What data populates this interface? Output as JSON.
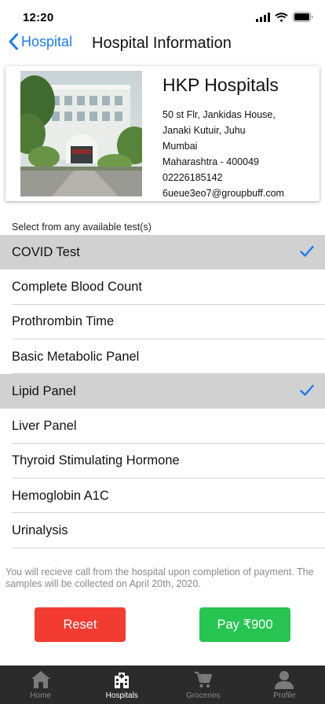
{
  "status": {
    "time": "12:20"
  },
  "nav": {
    "back_label": "Hospital",
    "title": "Hospital Information"
  },
  "hospital": {
    "name": "HKP Hospitals",
    "address_lines": [
      "50 st Flr, Jankidas House,",
      "Janaki Kutuir, Juhu",
      "Mumbai",
      "Maharashtra - 400049",
      "02226185142",
      "6ueue3eo7@groupbuff.com"
    ]
  },
  "tests": {
    "caption": "Select from any available test(s)",
    "items": [
      {
        "label": "COVID Test",
        "selected": true
      },
      {
        "label": "Complete Blood Count",
        "selected": false
      },
      {
        "label": "Prothrombin Time",
        "selected": false
      },
      {
        "label": "Basic Metabolic Panel",
        "selected": false
      },
      {
        "label": "Lipid Panel",
        "selected": true
      },
      {
        "label": "Liver Panel",
        "selected": false
      },
      {
        "label": "Thyroid Stimulating Hormone",
        "selected": false
      },
      {
        "label": "Hemoglobin A1C",
        "selected": false
      },
      {
        "label": "Urinalysis",
        "selected": false
      }
    ]
  },
  "note": "You will recieve call from the hospital upon completion of payment. The samples will be collected on April 20th, 2020.",
  "actions": {
    "reset_label": "Reset",
    "pay_label": "Pay ₹900"
  },
  "tabs": [
    {
      "label": "Home",
      "icon": "home-icon",
      "active": false
    },
    {
      "label": "Hospitals",
      "icon": "hospital-icon",
      "active": true
    },
    {
      "label": "Groceries",
      "icon": "cart-icon",
      "active": false
    },
    {
      "label": "Profile",
      "icon": "person-icon",
      "active": false
    }
  ],
  "colors": {
    "accent": "#1a7bf2",
    "reset": "#f23c32",
    "pay": "#27c451",
    "selected_row": "#d1d1d1",
    "tab_bar": "#2b2b2b"
  }
}
